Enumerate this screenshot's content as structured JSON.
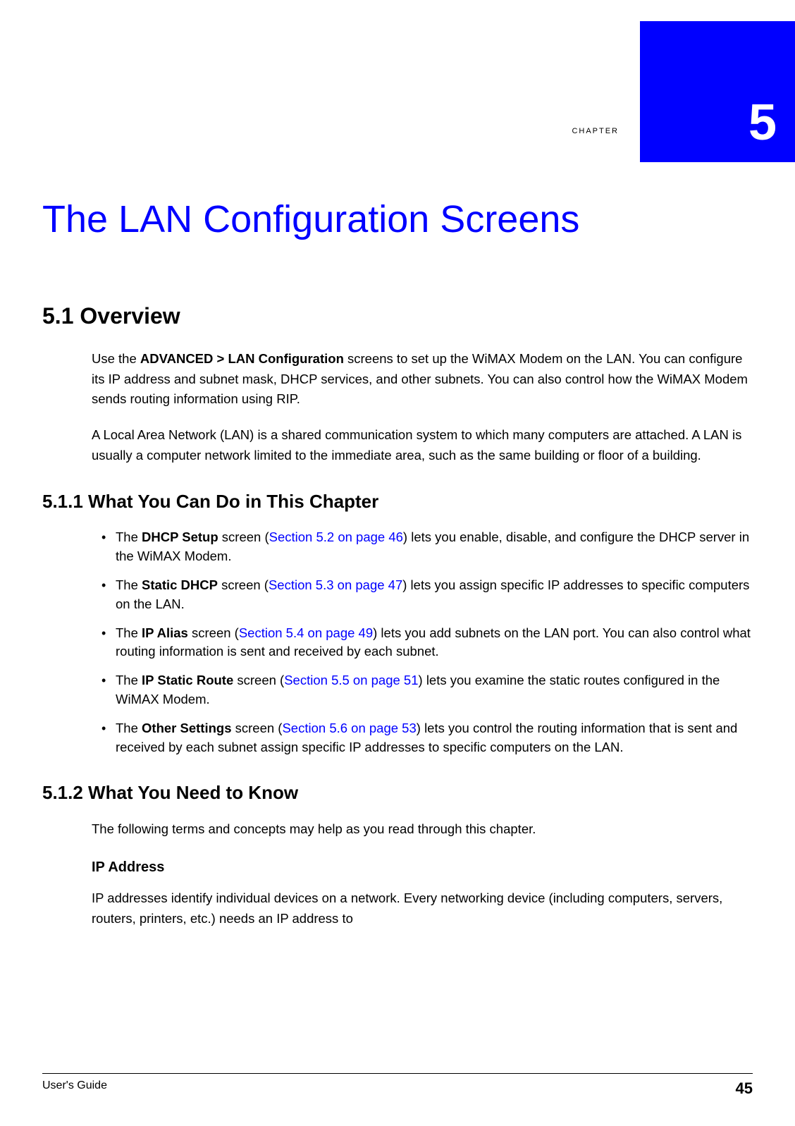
{
  "chapter": {
    "number": "5",
    "word": "CHAPTER",
    "title": "The LAN Configuration Screens"
  },
  "sections": {
    "overview_heading": "5.1  Overview",
    "overview_p1_pre": "Use the ",
    "overview_p1_bold": "ADVANCED > LAN Configuration",
    "overview_p1_post": " screens to set up the WiMAX Modem on the LAN. You can configure its IP address and subnet mask, DHCP services, and other subnets. You can also control how the WiMAX Modem sends routing information using RIP.",
    "overview_p2": "A Local Area Network (LAN) is a shared communication system to which many computers are attached. A LAN is usually a computer network limited to the immediate area, such as the same building or floor of a building.",
    "what_can_do_heading": "5.1.1  What You Can Do in This Chapter",
    "bullets": [
      {
        "pre": "The ",
        "bold": "DHCP Setup",
        "mid": " screen (",
        "link": "Section 5.2 on page 46",
        "post": ") lets you enable, disable, and configure the DHCP server in the WiMAX Modem."
      },
      {
        "pre": "The ",
        "bold": "Static DHCP",
        "mid": " screen (",
        "link": "Section 5.3 on page 47",
        "post": ") lets you assign specific IP addresses to specific computers on the LAN."
      },
      {
        "pre": "The ",
        "bold": "IP Alias",
        "mid": " screen (",
        "link": "Section 5.4 on page 49",
        "post": ") lets you add subnets on the LAN port. You can also control what routing information is sent and received by each subnet."
      },
      {
        "pre": "The  ",
        "bold": "IP Static Route",
        "mid": " screen (",
        "link": "Section 5.5 on page 51",
        "post": ") lets you examine the static routes configured in the WiMAX Modem."
      },
      {
        "pre": "The ",
        "bold": "Other Settings",
        "mid": " screen (",
        "link": "Section 5.6 on page 53",
        "post": ") lets you control the routing information that is sent and received by each subnet assign specific IP addresses to specific computers on the LAN."
      }
    ],
    "need_to_know_heading": "5.1.2  What You Need to Know",
    "need_to_know_p1": "The following terms and concepts may help as you read through this chapter.",
    "ip_address_heading": "IP Address",
    "ip_address_p1": "IP addresses identify individual devices on a network. Every networking device (including computers, servers, routers, printers, etc.) needs an IP address to"
  },
  "footer": {
    "guide": "User's Guide",
    "page": "45"
  }
}
